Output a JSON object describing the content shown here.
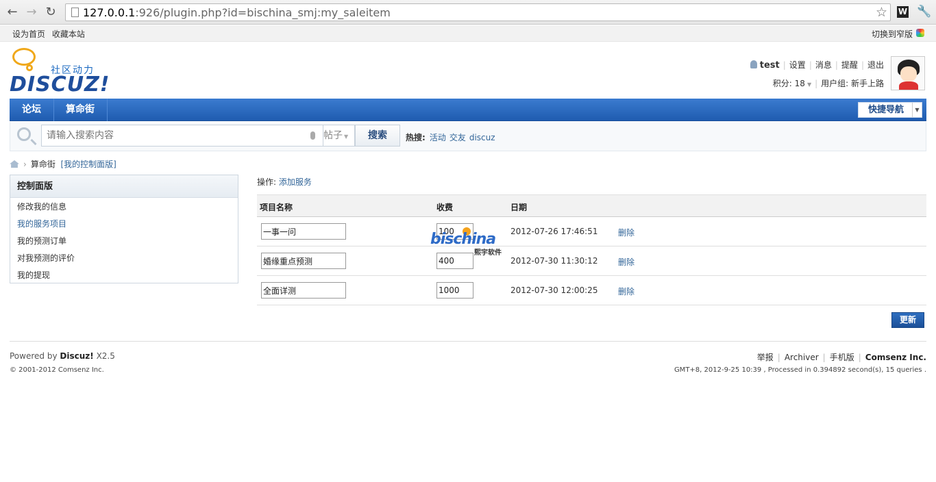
{
  "browser": {
    "url_host": "127.0.0.1",
    "url_rest": ":926/plugin.php?id=bischina_smj:my_saleitem",
    "extension_label": "W"
  },
  "topbar": {
    "set_home": "设为首页",
    "bookmark": "收藏本站",
    "switch_width": "切换到窄版"
  },
  "logo": {
    "tagline": "社区动力",
    "brand": "DISCUZ!"
  },
  "user": {
    "name": "test",
    "settings": "设置",
    "messages": "消息",
    "reminders": "提醒",
    "logout": "退出",
    "credits": "积分: 18",
    "group": "用户组: 新手上路"
  },
  "nav": {
    "items": [
      "论坛",
      "算命街"
    ],
    "quick_nav": "快捷导航"
  },
  "search": {
    "placeholder": "请输入搜索内容",
    "type": "帖子",
    "button": "搜索",
    "hot_label": "热搜:",
    "hot_terms": [
      "活动",
      "交友",
      "discuz"
    ]
  },
  "breadcrumb": {
    "current": "算命街",
    "link": "[我的控制面版]"
  },
  "sidebar": {
    "title": "控制面版",
    "items": [
      "修改我的信息",
      "我的服务项目",
      "我的预测订单",
      "对我预测的评价",
      "我的提现"
    ]
  },
  "main": {
    "ops_label": "操作:",
    "add_service": "添加服务",
    "columns": [
      "项目名称",
      "收费",
      "日期"
    ],
    "rows": [
      {
        "name": "一事一问",
        "fee": "100",
        "date": "2012-07-26 17:46:51",
        "action": "删除"
      },
      {
        "name": "婚缘重点预测",
        "fee": "400",
        "date": "2012-07-30 11:30:12",
        "action": "删除"
      },
      {
        "name": "全面详测",
        "fee": "1000",
        "date": "2012-07-30 12:00:25",
        "action": "删除"
      }
    ],
    "update_button": "更新"
  },
  "watermark": {
    "brand": "bischina",
    "sub": "熙宇软件"
  },
  "footer": {
    "powered_prefix": "Powered by",
    "powered_brand": "Discuz!",
    "powered_version": "X2.5",
    "copyright": "© 2001-2012 Comsenz Inc.",
    "links": [
      "举报",
      "Archiver",
      "手机版"
    ],
    "company": "Comsenz Inc.",
    "gmt": "GMT+8, 2012-9-25 10:39 , Processed in 0.394892 second(s), 15 queries ."
  }
}
